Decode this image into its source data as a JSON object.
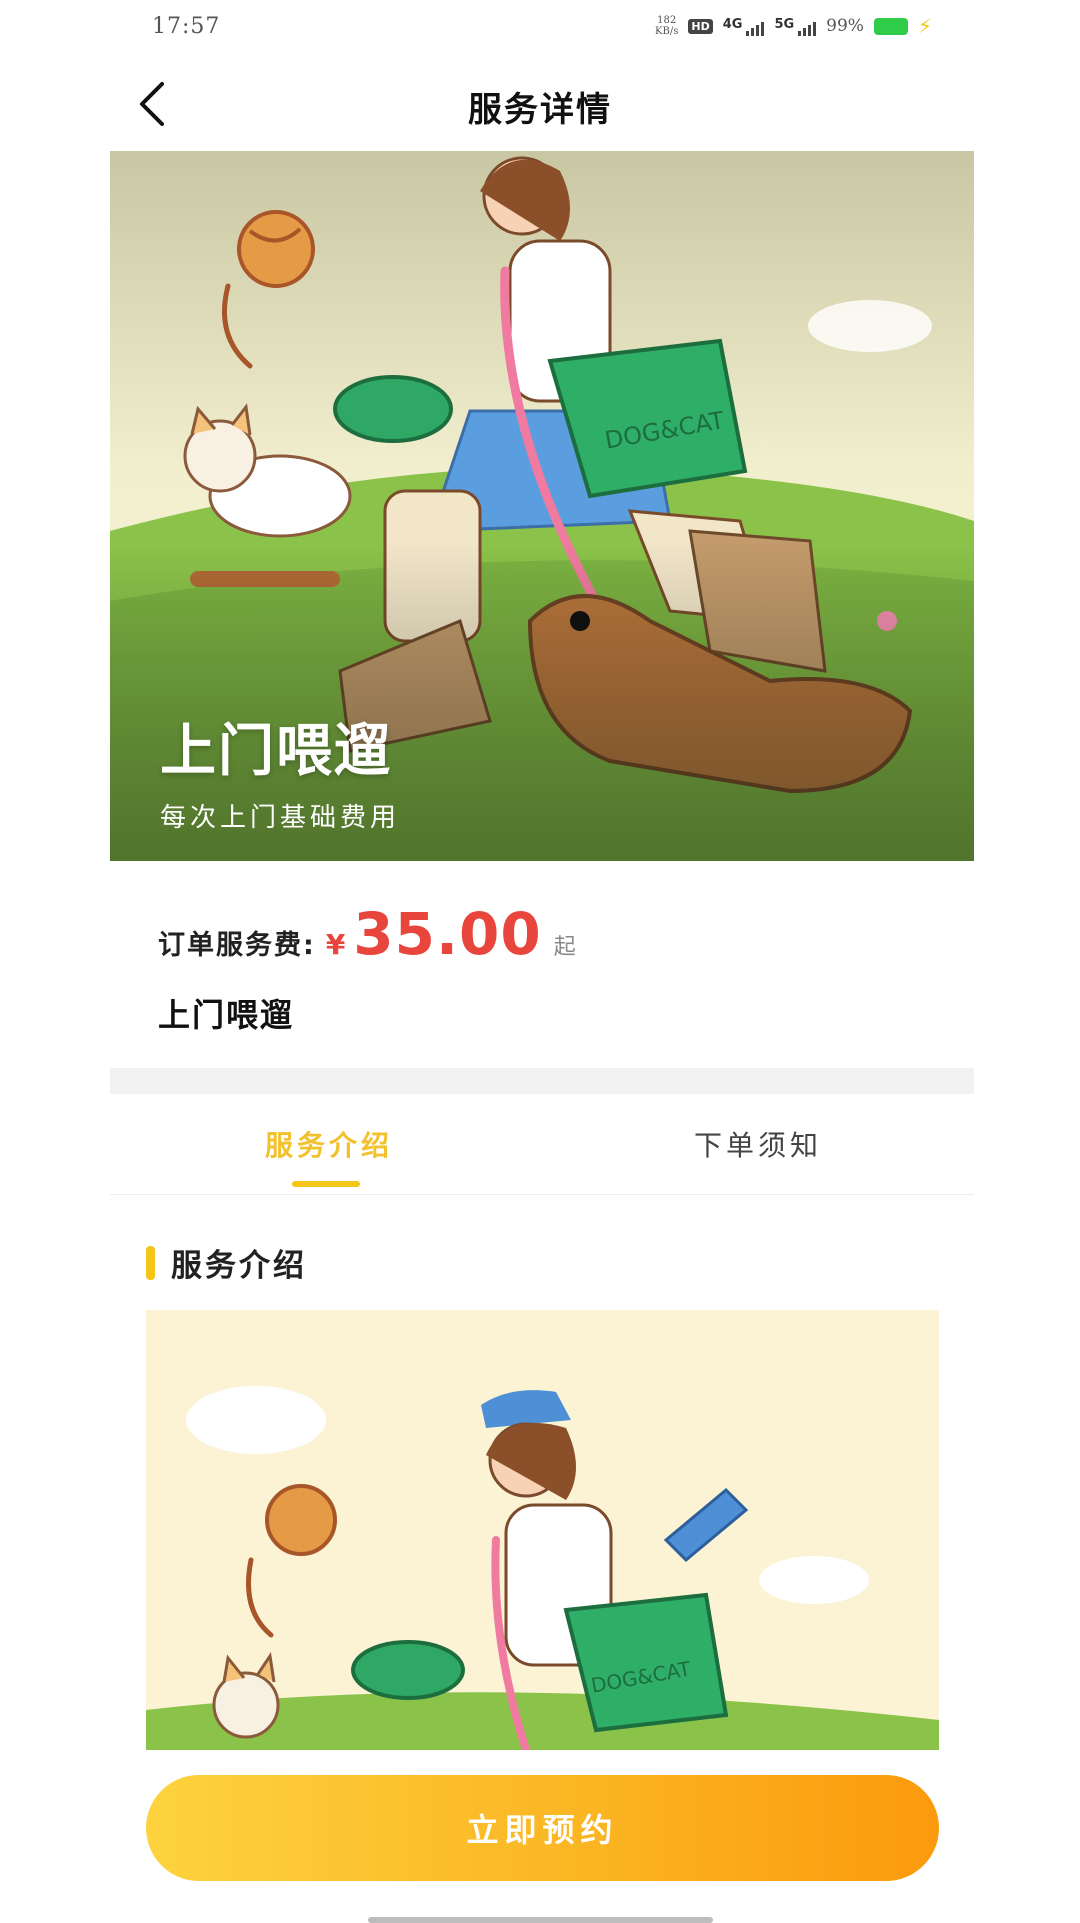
{
  "status": {
    "time": "17:57",
    "net_speed_value": "182",
    "net_speed_unit": "KB/s",
    "hd_label": "HD",
    "sim1_label": "4G",
    "sim2_label": "5G",
    "battery": "99%",
    "battery_color": "#2ecc49"
  },
  "nav": {
    "title": "服务详情",
    "back_icon": "chevron-left-icon"
  },
  "hero": {
    "title": "上门喂遛",
    "subtitle": "每次上门基础费用"
  },
  "price": {
    "label": "订单服务费:",
    "currency": "¥",
    "value": "35.00",
    "suffix": "起",
    "service_name": "上门喂遛",
    "accent_color": "#e8453c"
  },
  "tabs": [
    {
      "label": "服务介绍",
      "active": true
    },
    {
      "label": "下单须知",
      "active": false
    }
  ],
  "section": {
    "title": "服务介绍"
  },
  "illustration": {
    "bag_text": "DOG&CAT"
  },
  "cta": {
    "label": "立即预约"
  },
  "colors": {
    "brand_yellow": "#f5c518",
    "button_start": "#fdd33e",
    "button_end": "#fb9a0c"
  }
}
